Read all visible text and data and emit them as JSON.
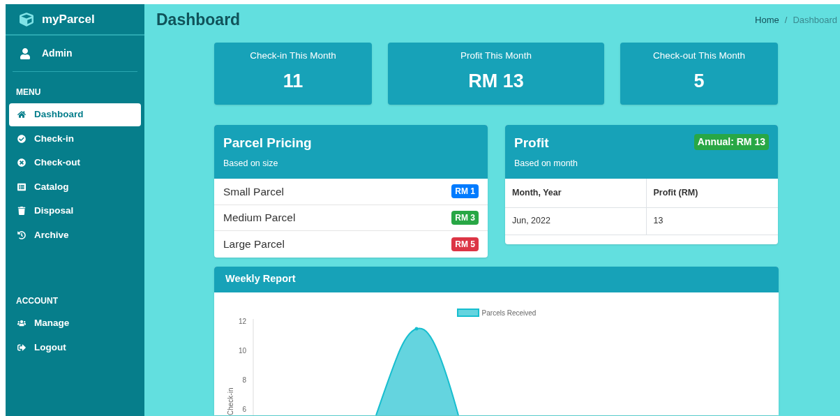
{
  "sidebar": {
    "brand": "myParcel",
    "user": "Admin",
    "sections": [
      {
        "title": "MENU",
        "items": [
          {
            "label": "Dashboard",
            "selected": true
          },
          {
            "label": "Check-in",
            "selected": false
          },
          {
            "label": "Check-out",
            "selected": false
          },
          {
            "label": "Catalog",
            "selected": false
          },
          {
            "label": "Disposal",
            "selected": false
          },
          {
            "label": "Archive",
            "selected": false
          }
        ]
      },
      {
        "title": "ACCOUNT",
        "items": [
          {
            "label": "Manage",
            "selected": false
          },
          {
            "label": "Logout",
            "selected": false
          }
        ]
      }
    ]
  },
  "header": {
    "title": "Dashboard",
    "breadcrumb": [
      "Home",
      "Dashboard"
    ],
    "separator": "/"
  },
  "stats": [
    {
      "label": "Check-in This Month",
      "value": "11"
    },
    {
      "label": "Profit This Month",
      "value": "RM 13"
    },
    {
      "label": "Check-out This Month",
      "value": "5"
    }
  ],
  "pricing": {
    "title": "Parcel Pricing",
    "subtitle": "Based on size",
    "items": [
      {
        "name": "Small Parcel",
        "price": "RM 1",
        "color": "#007bff"
      },
      {
        "name": "Medium Parcel",
        "price": "RM 3",
        "color": "#28a745"
      },
      {
        "name": "Large Parcel",
        "price": "RM 5",
        "color": "#dc3545"
      }
    ]
  },
  "profit": {
    "title": "Profit",
    "subtitle": "Based on month",
    "annual": "Annual: RM 13",
    "columns": [
      "Month, Year",
      "Profit (RM)"
    ],
    "rows": [
      [
        "Jun, 2022",
        "13"
      ]
    ]
  },
  "weekly": {
    "title": "Weekly Report",
    "chart": {
      "legend": "Parcels Received",
      "ylabel": "Check-in",
      "yticks": [
        "12",
        "10",
        "8",
        "6"
      ]
    }
  }
}
